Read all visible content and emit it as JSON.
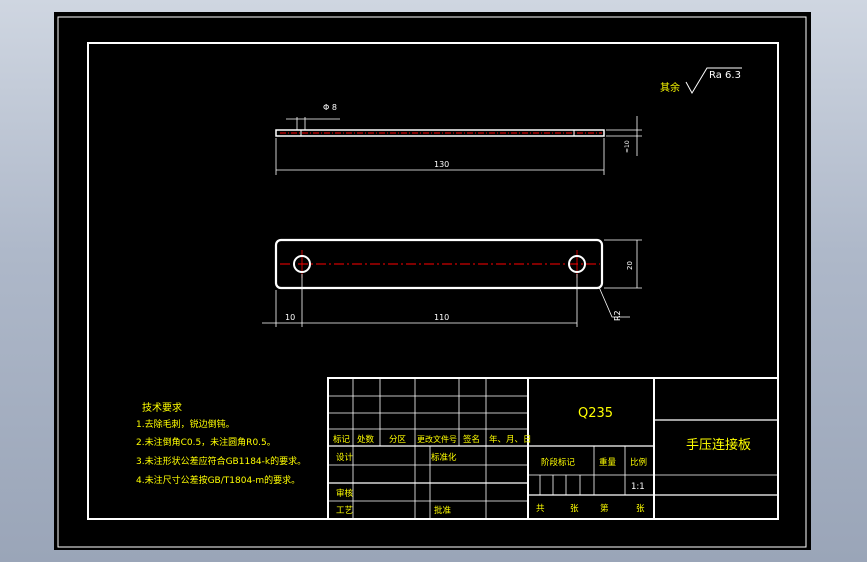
{
  "drawing": {
    "surface_roughness": {
      "prefix": "其余",
      "value": "Ra 6.3"
    },
    "top_view": {
      "hole_dim": "Φ 8",
      "length_dim": "130",
      "thickness_dim": "≈10"
    },
    "front_view": {
      "height_dim": "20",
      "offset_dim": "10",
      "spacing_dim": "110",
      "radius_dim": "R2"
    },
    "tech_requirements": {
      "title": "技术要求",
      "items": [
        "1.去除毛刺，锐边倒钝。",
        "2.未注倒角C0.5，未注圆角R0.5。",
        "3.未注形状公差应符合GB1184-k的要求。",
        "4.未注尺寸公差按GB/T1804-m的要求。"
      ]
    },
    "title_block": {
      "material": "Q235",
      "part_name": "手压连接板",
      "rev_headers": [
        "标记",
        "处数",
        "分区",
        "更改文件号",
        "签名",
        "年、月、日"
      ],
      "design": "设计",
      "standardize": "标准化",
      "stage_mark": "阶段标记",
      "weight": "重量",
      "scale_label": "比例",
      "scale": "1:1",
      "review": "审核",
      "process": "工艺",
      "approve": "批准",
      "sheets": [
        "共",
        "张",
        "第",
        "张"
      ]
    }
  },
  "colors": {
    "background": "#000000",
    "lines": "#ffffff",
    "centerline": "#ff0000",
    "dimensions": "#00ff00",
    "text_yellow": "#ffff00"
  }
}
